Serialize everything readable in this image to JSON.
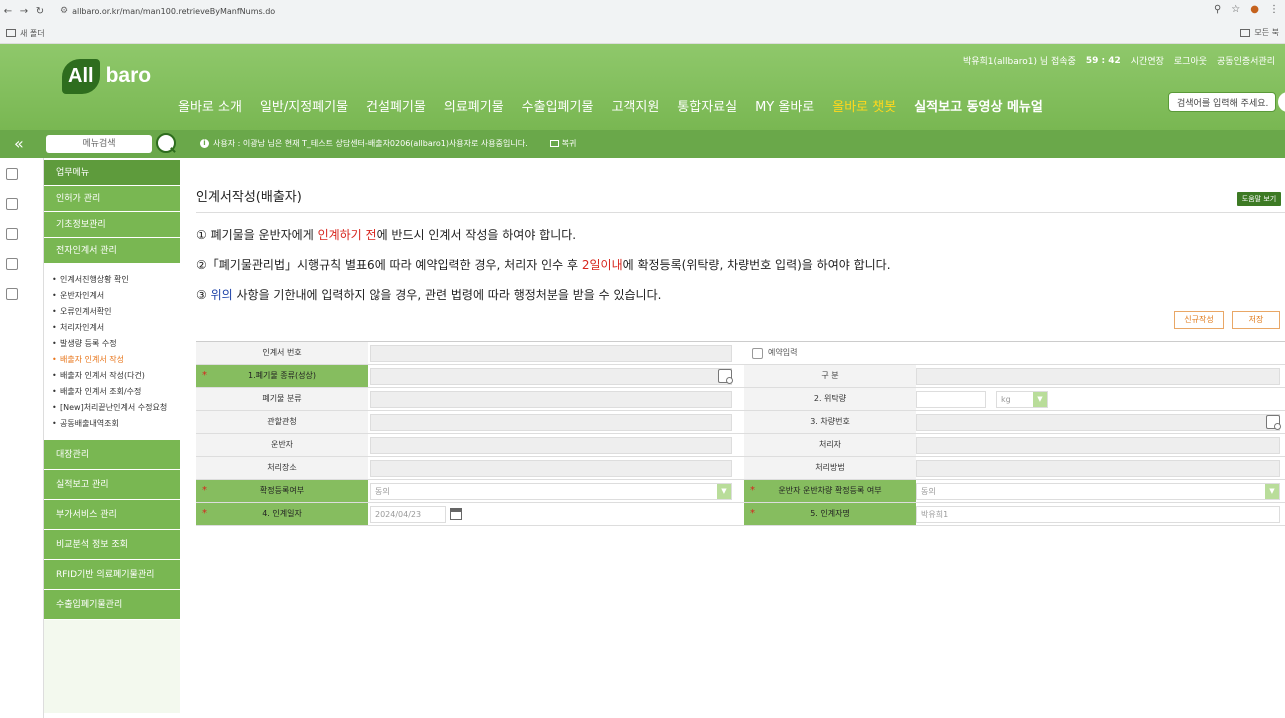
{
  "browser": {
    "url": "allbaro.or.kr/man/man100.retrieveByManfNums.do",
    "bookmark": "새 폴더",
    "bookmarks_right": "모든 북"
  },
  "header": {
    "util": {
      "user": "박유희1(allbaro1) 님 접속중",
      "timer": "59 : 42",
      "extend": "시간연장",
      "logout": "로그아웃",
      "cert": "공동인증서관리"
    },
    "logo": {
      "all": "All",
      "baro": "baro"
    },
    "gnb": [
      "올바로 소개",
      "일반/지정폐기물",
      "건설폐기물",
      "의료폐기물",
      "수출입폐기물",
      "고객지원",
      "통합자료실",
      "MY 올바로",
      "올바로 챗봇",
      "실적보고 동영상 메뉴얼"
    ],
    "search_placeholder": "검색어를 입력해 주세요."
  },
  "subbar": {
    "collapse": "«",
    "menu_search": "메뉴검색",
    "notice": "사용자 : 이광남 님은 현재 T_테스트 상담센터-배출자0206(allbaro1)사용자로 사용중입니다.",
    "recover": "복귀"
  },
  "lnb": {
    "header": "업무메뉴",
    "top": [
      "인허가 관리",
      "기초정보관리",
      "전자인계서 관리"
    ],
    "sub": [
      "인계서진행상황 확인",
      "운반자인계서",
      "오류인계서확인",
      "처리자인계서",
      "발생량 등록 수정",
      "배출자 인계서 작성",
      "배출자 인계서 작성(다건)",
      "배출자 인계서 조회/수정",
      "[New]처리끝난인계서 수정요청",
      "공동배출내역조회"
    ],
    "bottom": [
      "대장관리",
      "실적보고 관리",
      "부가서비스 관리",
      "비교분석 정보 조회",
      "RFID기반 의료폐기물관리",
      "수출입폐기물관리"
    ]
  },
  "main": {
    "title": "인계서작성(배출자)",
    "help": "도움말 보기",
    "inst1": {
      "a": "① 폐기물을 운반자에게 ",
      "b": "인계하기 전",
      "c": "에 반드시 인계서 작성을 하여야 합니다."
    },
    "inst2": {
      "a": "②「폐기물관리법」시행규칙 별표6에 따라 예약입력한 경우, 처리자 인수 후 ",
      "b": "2일이내",
      "c": "에 확정등록(위탁량, 차량번호 입력)을 하여야 합니다."
    },
    "inst3": {
      "a": "③ ",
      "b": "위의",
      "c": " 사항을 기한내에 입력하지 않을 경우, 관련 법령에 따라 행정처분을 받을 수 있습니다."
    },
    "new_btn": "신규작성",
    "save_btn": "저장"
  },
  "form": {
    "manifest_no": "인계서 번호",
    "reserve": "예약입력",
    "waste_type": "1.폐기물 종류(성상)",
    "division": "구 분",
    "waste_class": "폐기물 분류",
    "amount": "2. 위탁량",
    "unit": "kg",
    "office": "관할관청",
    "vehicle": "3. 차량번호",
    "carrier": "운반자",
    "processor": "처리자",
    "site": "처리장소",
    "method": "처리방법",
    "confirm": "확정등록여부",
    "confirm_val": "동의",
    "carrier_confirm": "운반자 운반차량 확정등록 여부",
    "carrier_confirm_val": "동의",
    "date": "4. 인계일자",
    "date_val": "2024/04/23",
    "signer": "5. 인계자명",
    "signer_val": "박유희1"
  }
}
